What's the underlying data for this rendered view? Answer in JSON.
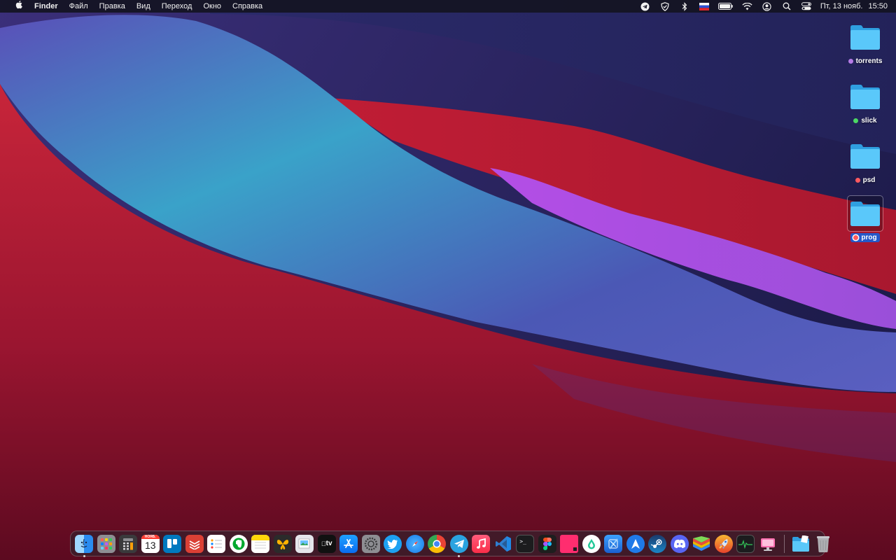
{
  "menubar": {
    "app_name": "Finder",
    "menus": [
      "Файл",
      "Правка",
      "Вид",
      "Переход",
      "Окно",
      "Справка"
    ],
    "status_icons": [
      "telegram-icon",
      "shield-icon",
      "bluetooth-icon",
      "flag-ru-icon",
      "battery-icon",
      "wifi-icon",
      "user-icon",
      "search-icon",
      "control-center-icon"
    ],
    "date": "Пт, 13 нояб.",
    "time": "15:50"
  },
  "desktop": {
    "icons": [
      {
        "label": "torrents",
        "tag_color": "#b57be6",
        "selected": false
      },
      {
        "label": "slick",
        "tag_color": "#4cd964",
        "selected": false
      },
      {
        "label": "psd",
        "tag_color": "#ff5a5f",
        "selected": false
      },
      {
        "label": "prog",
        "tag_color": "#ff5a5f",
        "selected": true
      }
    ]
  },
  "dock": {
    "apps": [
      {
        "name": "finder-icon",
        "running": true
      },
      {
        "name": "launchpad-icon",
        "running": false
      },
      {
        "name": "calculator-icon",
        "running": false
      },
      {
        "name": "calendar-icon",
        "running": false,
        "month": "НОЯБ.",
        "day": "13"
      },
      {
        "name": "trello-icon",
        "running": false
      },
      {
        "name": "todoist-icon",
        "running": false
      },
      {
        "name": "reminders-icon",
        "running": false
      },
      {
        "name": "evernote-icon",
        "running": false
      },
      {
        "name": "notes-icon",
        "running": false
      },
      {
        "name": "tes-icon",
        "running": false
      },
      {
        "name": "preview-icon",
        "running": false
      },
      {
        "name": "apple-tv-icon",
        "running": false,
        "text": "tv"
      },
      {
        "name": "app-store-icon",
        "running": false
      },
      {
        "name": "system-preferences-icon",
        "running": false
      },
      {
        "name": "twitter-icon",
        "running": false
      },
      {
        "name": "safari-icon",
        "running": false
      },
      {
        "name": "chrome-icon",
        "running": false
      },
      {
        "name": "telegram-icon",
        "running": true
      },
      {
        "name": "music-icon",
        "running": false
      },
      {
        "name": "vscode-icon",
        "running": false
      },
      {
        "name": "terminal-icon",
        "running": false
      },
      {
        "name": "figma-icon",
        "running": false
      },
      {
        "name": "pink-square-icon",
        "running": false
      },
      {
        "name": "drop-icon",
        "running": false
      },
      {
        "name": "xcode-icon",
        "running": false
      },
      {
        "name": "arrow-navigation-icon",
        "running": false
      },
      {
        "name": "steam-icon",
        "running": false
      },
      {
        "name": "discord-icon",
        "running": false
      },
      {
        "name": "bluestacks-icon",
        "running": false
      },
      {
        "name": "rocket-icon",
        "running": false
      },
      {
        "name": "activity-monitor-icon",
        "running": false
      },
      {
        "name": "screen-sharing-icon",
        "running": false
      }
    ],
    "right": [
      {
        "name": "downloads-folder-icon"
      },
      {
        "name": "trash-icon"
      }
    ]
  },
  "colors": {
    "folder_blue": "#5ac8fa",
    "selection_blue": "#2458c9"
  }
}
